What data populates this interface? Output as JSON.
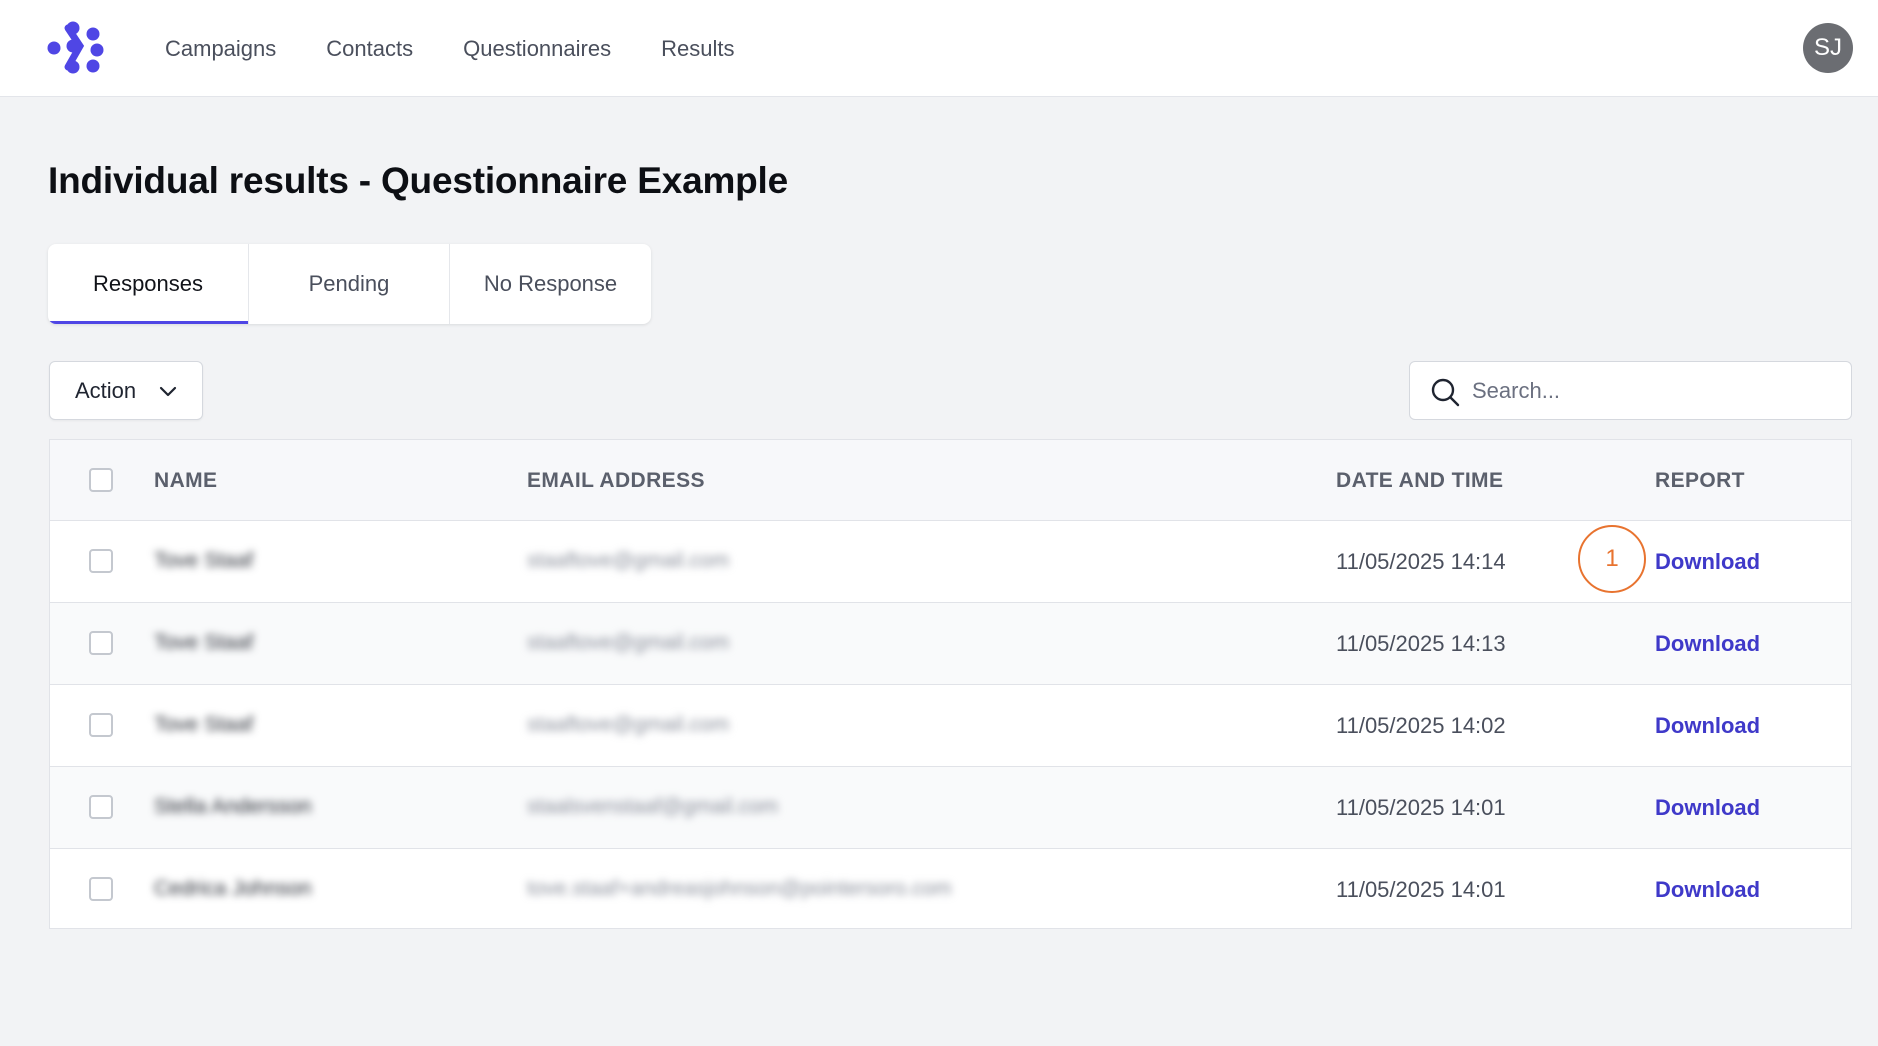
{
  "nav": {
    "items": [
      "Campaigns",
      "Contacts",
      "Questionnaires",
      "Results"
    ]
  },
  "user": {
    "initials": "SJ"
  },
  "page": {
    "title": "Individual results - Questionnaire Example"
  },
  "tabs": [
    {
      "label": "Responses",
      "active": true
    },
    {
      "label": "Pending",
      "active": false
    },
    {
      "label": "No Response",
      "active": false
    }
  ],
  "toolbar": {
    "action_label": "Action",
    "search_placeholder": "Search..."
  },
  "table": {
    "headers": {
      "name": "NAME",
      "email": "EMAIL ADDRESS",
      "date": "DATE AND TIME",
      "report": "REPORT"
    },
    "rows": [
      {
        "name": "Tove Staaf",
        "email": "staaftove@gmail.com",
        "date": "11/05/2025 14:14",
        "report": "Download"
      },
      {
        "name": "Tove Staaf",
        "email": "staaftove@gmail.com",
        "date": "11/05/2025 14:13",
        "report": "Download"
      },
      {
        "name": "Tove Staaf",
        "email": "staaftove@gmail.com",
        "date": "11/05/2025 14:02",
        "report": "Download"
      },
      {
        "name": "Stella Andersson",
        "email": "staalsvenstaaf@gmail.com",
        "date": "11/05/2025 14:01",
        "report": "Download"
      },
      {
        "name": "Cedrica Johnson",
        "email": "tove.staaf+andreasjohnson@pointersoro.com",
        "date": "11/05/2025 14:01",
        "report": "Download"
      }
    ]
  },
  "annotation": {
    "step_number": "1"
  },
  "colors": {
    "accent": "#4f46e5",
    "link": "#3f39c9",
    "marker": "#e8732f"
  }
}
